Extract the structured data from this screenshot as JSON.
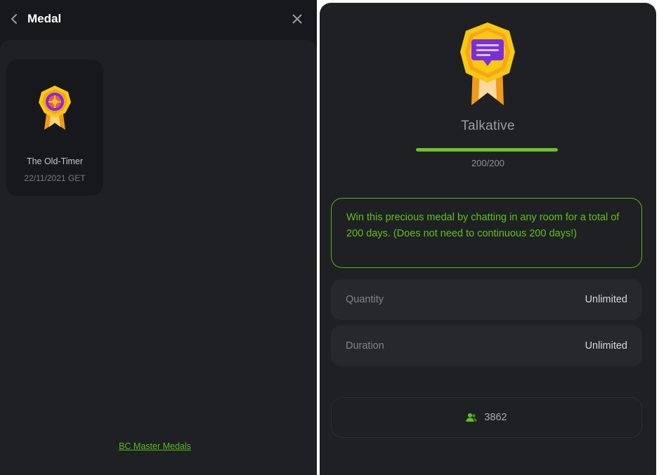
{
  "left": {
    "title": "Medal",
    "medals": [
      {
        "name": "The Old-Timer",
        "date": "22/11/2021 GET",
        "icon": "old-timer-medal-icon"
      }
    ],
    "master_link": "BC Master Medals"
  },
  "detail": {
    "title": "Talkative",
    "icon": "talkative-medal-icon",
    "progress": {
      "current": 200,
      "total": 200,
      "text": "200/200",
      "fraction": 1.0
    },
    "description": "Win this precious medal by chatting in any room for a total of 200 days. (Does not need to continuous 200 days!)",
    "rows": [
      {
        "label": "Quantity",
        "value": "Unlimited"
      },
      {
        "label": "Duration",
        "value": "Unlimited"
      }
    ],
    "holders": "3862"
  },
  "colors": {
    "accent_green": "#5cc21d",
    "panel_bg": "#1f2023",
    "header_bg": "#17181b",
    "medal_gold": "#f6c913",
    "medal_orange": "#f29a1a",
    "medal_purple": "#7b2fd8"
  }
}
